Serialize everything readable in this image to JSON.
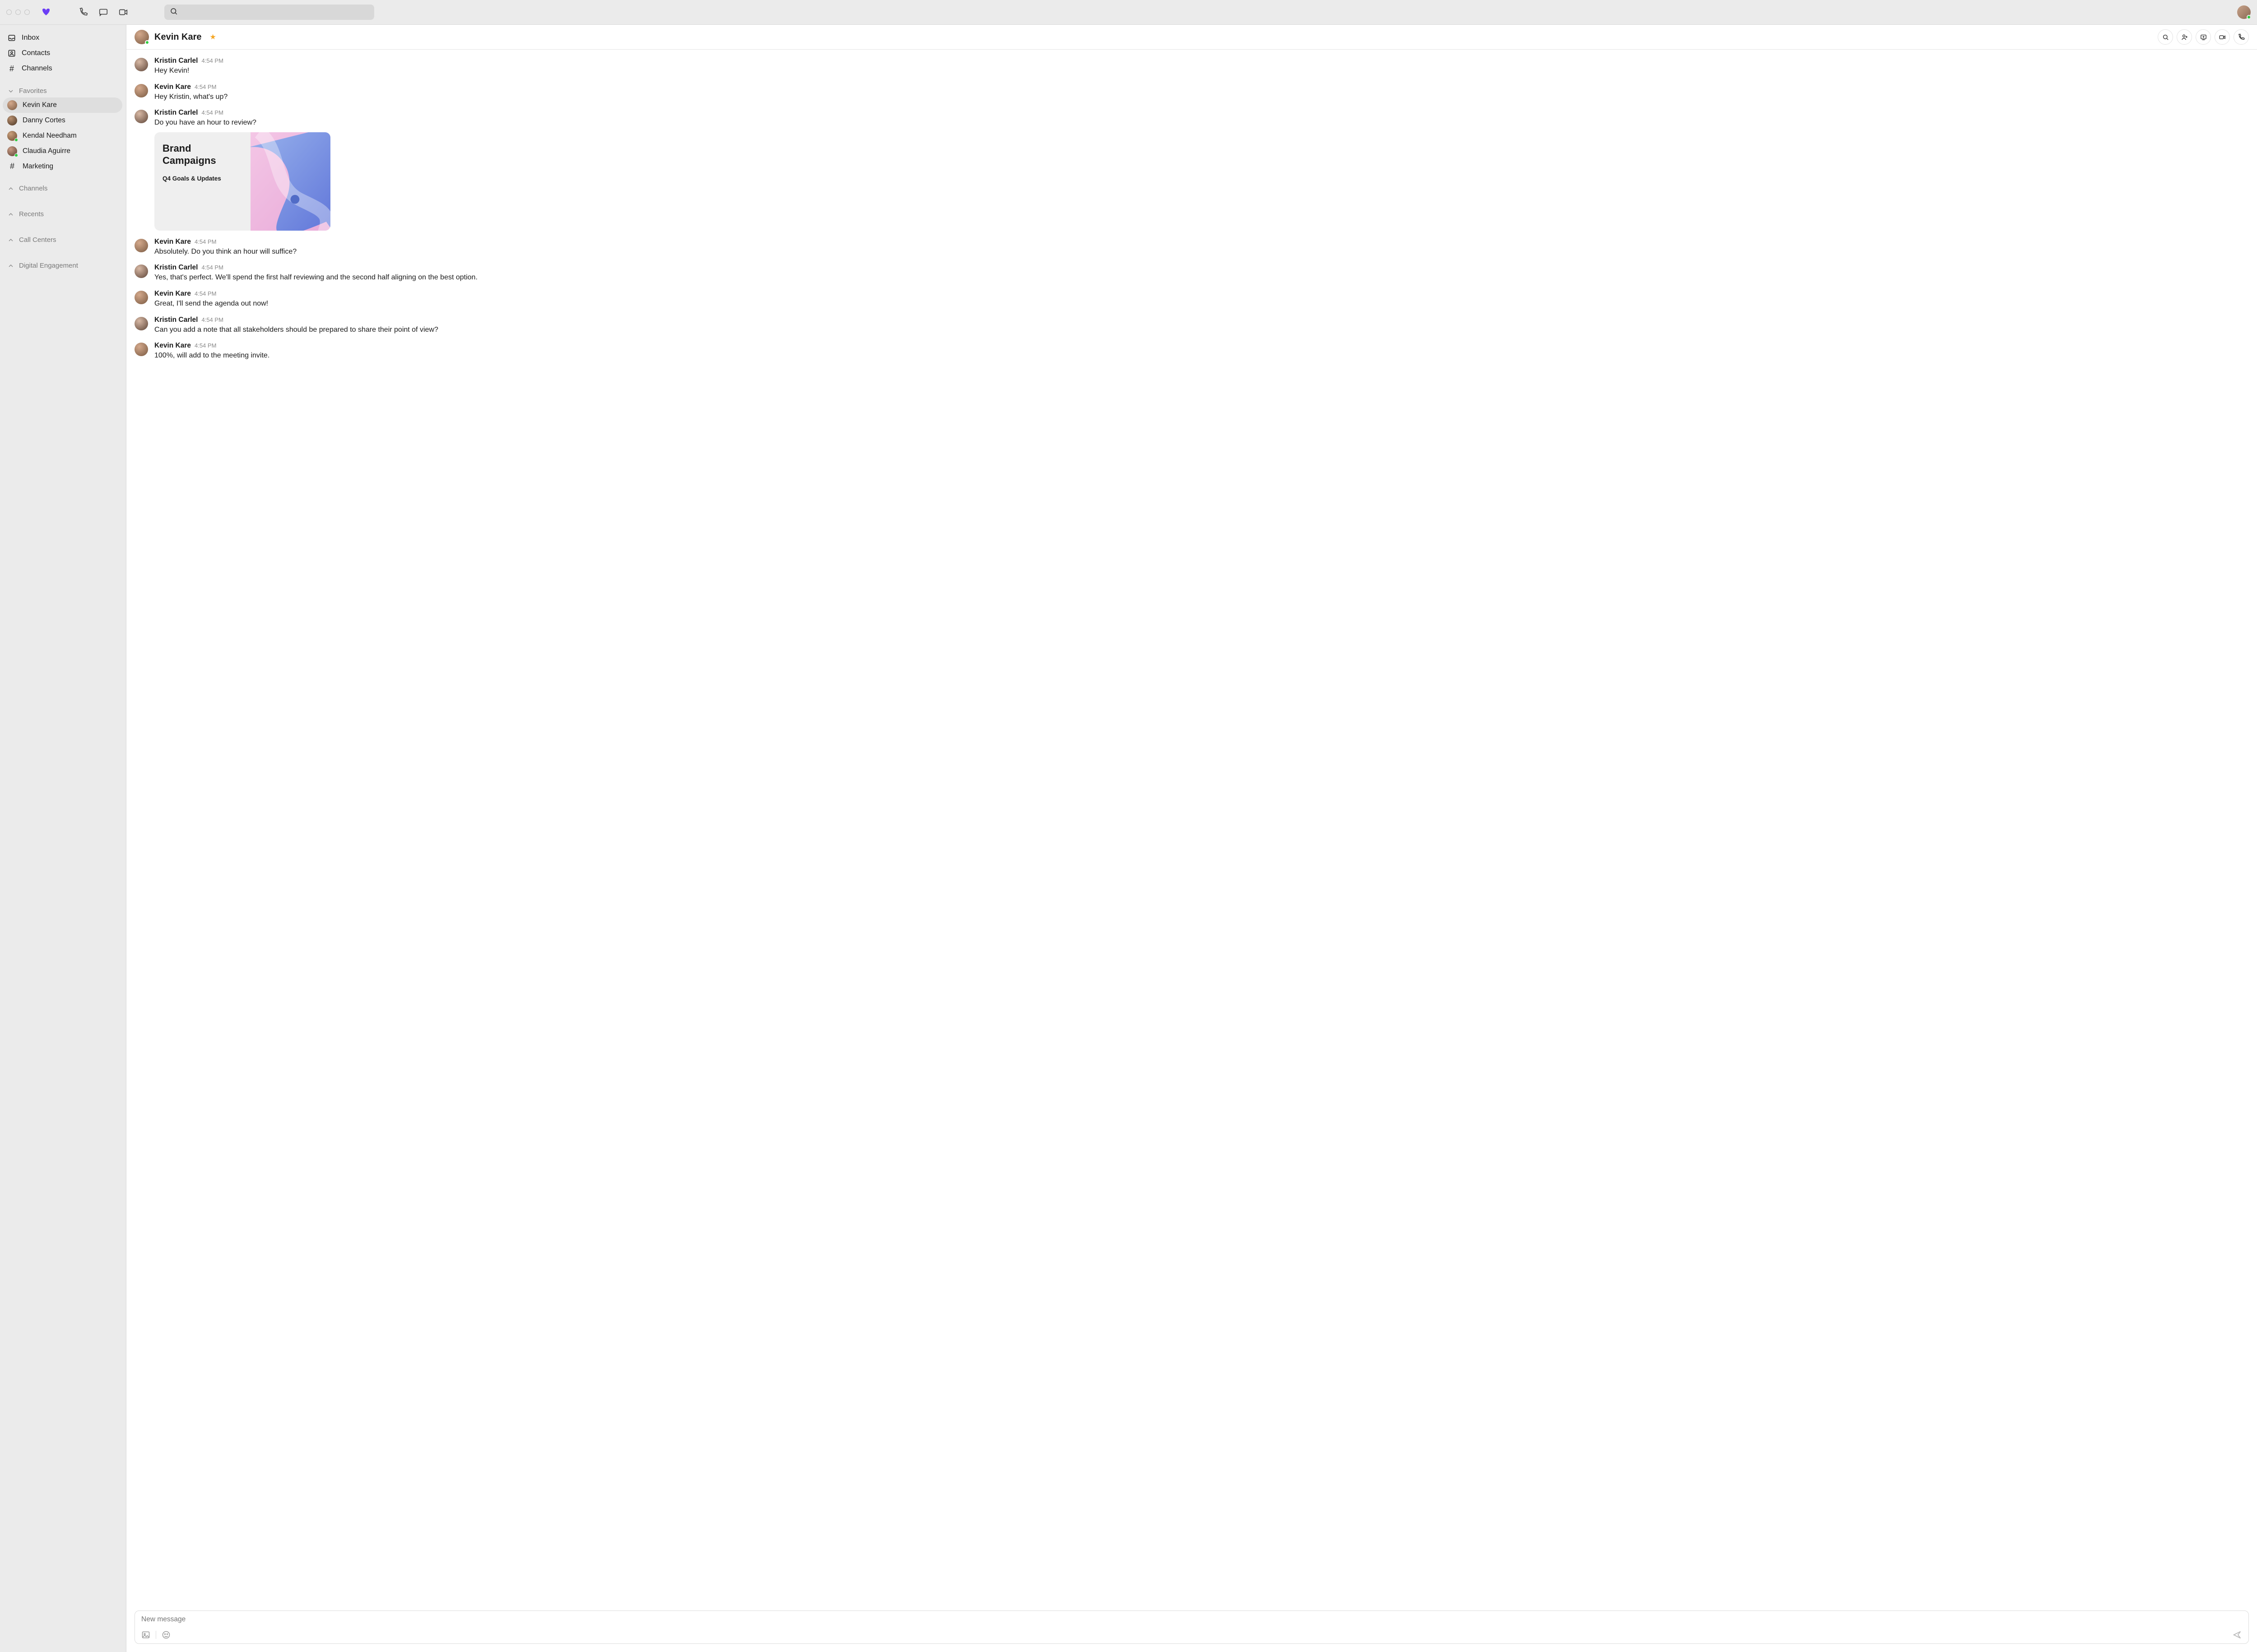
{
  "sidebar": {
    "nav": [
      {
        "label": "Inbox"
      },
      {
        "label": "Contacts"
      },
      {
        "label": "Channels"
      }
    ],
    "favorites_header": "Favorites",
    "favorites": [
      {
        "label": "Kevin Kare",
        "presence": false,
        "active": true
      },
      {
        "label": "Danny Cortes",
        "presence": false,
        "active": false
      },
      {
        "label": "Kendal Needham",
        "presence": true,
        "active": false
      },
      {
        "label": "Claudia Aguirre",
        "presence": true,
        "active": false
      }
    ],
    "fav_channel": "Marketing",
    "sections": [
      "Channels",
      "Recents",
      "Call Centers",
      "Digital Engagement"
    ]
  },
  "conversation": {
    "title": "Kevin Kare",
    "starred": true
  },
  "messages": [
    {
      "author": "Kristin Carlel",
      "time": "4:54 PM",
      "text": "Hey Kevin!"
    },
    {
      "author": "Kevin Kare",
      "time": "4:54 PM",
      "text": "Hey Kristin, what's up?"
    },
    {
      "author": "Kristin Carlel",
      "time": "4:54 PM",
      "text": "Do you have an hour to review?",
      "attachment": {
        "title": "Brand Campaigns",
        "subtitle": "Q4 Goals & Updates"
      }
    },
    {
      "author": "Kevin Kare",
      "time": "4:54 PM",
      "text": "Absolutely. Do you think an hour will suffice?"
    },
    {
      "author": "Kristin Carlel",
      "time": "4:54 PM",
      "text": "Yes, that's perfect. We'll spend the first half reviewing and the second half aligning on the best option."
    },
    {
      "author": "Kevin Kare",
      "time": "4:54 PM",
      "text": "Great, I'll send the agenda out now!"
    },
    {
      "author": "Kristin Carlel",
      "time": "4:54 PM",
      "text": "Can you add a note that all stakeholders should be prepared to share their point of view?"
    },
    {
      "author": "Kevin Kare",
      "time": "4:54 PM",
      "text": "100%, will add to the meeting invite."
    }
  ],
  "composer": {
    "placeholder": "New message"
  }
}
